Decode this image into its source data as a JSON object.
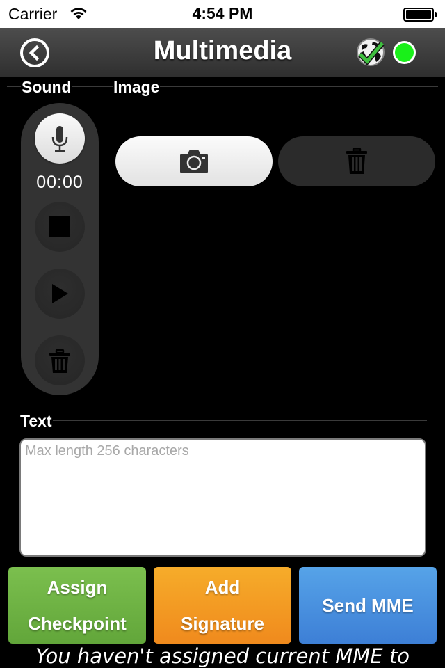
{
  "status_bar": {
    "carrier": "Carrier",
    "time": "4:54 PM",
    "battery_level": 1.0
  },
  "nav": {
    "title": "Multimedia",
    "back_icon": "chevron-left-circle-icon",
    "sync_icon": "globe-check-icon",
    "status_icon": "green-status-dot",
    "status_color": "#19f019"
  },
  "sections": {
    "sound": "Sound",
    "image": "Image",
    "text": "Text"
  },
  "sound": {
    "timer": "00:00",
    "record_icon": "microphone-icon",
    "stop_icon": "stop-icon",
    "play_icon": "play-icon",
    "delete_icon": "trash-icon"
  },
  "image": {
    "camera_icon": "camera-icon",
    "delete_icon": "trash-icon"
  },
  "text_input": {
    "value": "",
    "placeholder": "Max length 256 characters"
  },
  "actions": {
    "assign": {
      "line1": "Assign",
      "line2": "Checkpoint",
      "color": "#6eb243"
    },
    "signature": {
      "line1": "Add",
      "line2": "Signature",
      "color": "#f39c23"
    },
    "send": {
      "label": "Send MME",
      "color": "#4a91df"
    }
  },
  "footer_message": "You haven't assigned current MME to"
}
